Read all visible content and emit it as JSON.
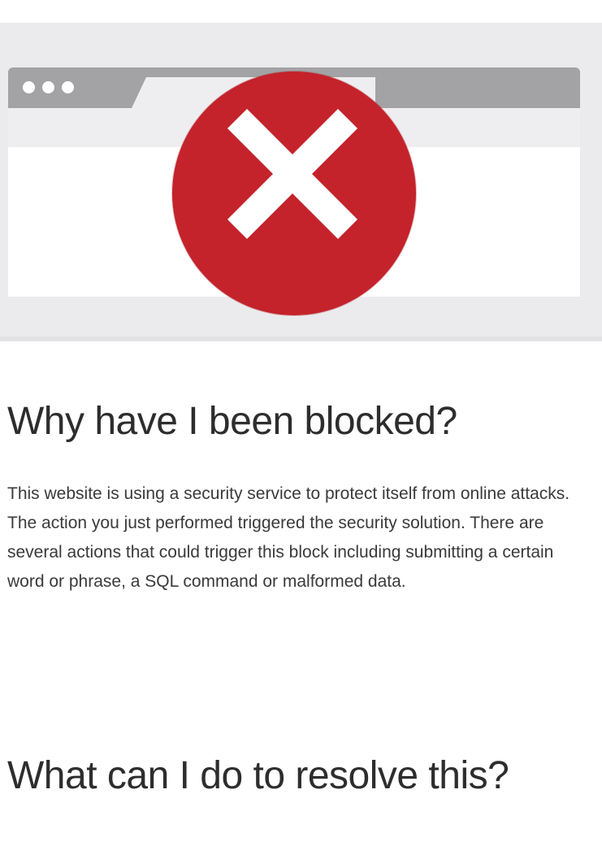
{
  "illustration": {
    "error_color": "#c4232b",
    "icon": "error-x-icon",
    "window_dots": 3
  },
  "headings": {
    "why_blocked": "Why have I been blocked?",
    "resolve": "What can I do to resolve this?"
  },
  "body": {
    "explanation": "This website is using a security service to protect itself from online attacks. The action you just performed triggered the security solution. There are several actions that could trigger this block including submitting a certain word or phrase, a SQL command or malformed data."
  }
}
